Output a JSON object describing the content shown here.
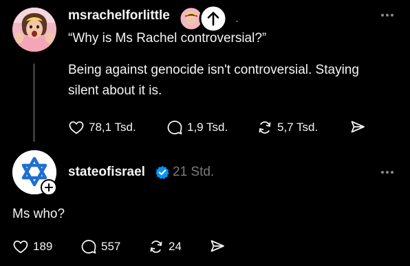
{
  "post1": {
    "username": "msrachelforlittle",
    "quote": "“Why is Ms Rachel controversial?”",
    "text": "Being against genocide isn't controversial. Staying silent about it is.",
    "likes": "78,1 Tsd.",
    "replies": "1,9 Tsd.",
    "reposts": "5,7 Tsd.",
    "more_icon": "more-horizontal-icon"
  },
  "post2": {
    "username": "stateofisrael",
    "time": "21 Std.",
    "text": "Ms who?",
    "likes": "189",
    "replies": "557",
    "reposts": "24",
    "more_icon": "more-horizontal-icon"
  },
  "colors": {
    "background": "#000000",
    "text": "#f3f5f7",
    "muted": "#7a7a7a",
    "verified": "#0095f6",
    "flag_blue": "#1f6fd1"
  }
}
